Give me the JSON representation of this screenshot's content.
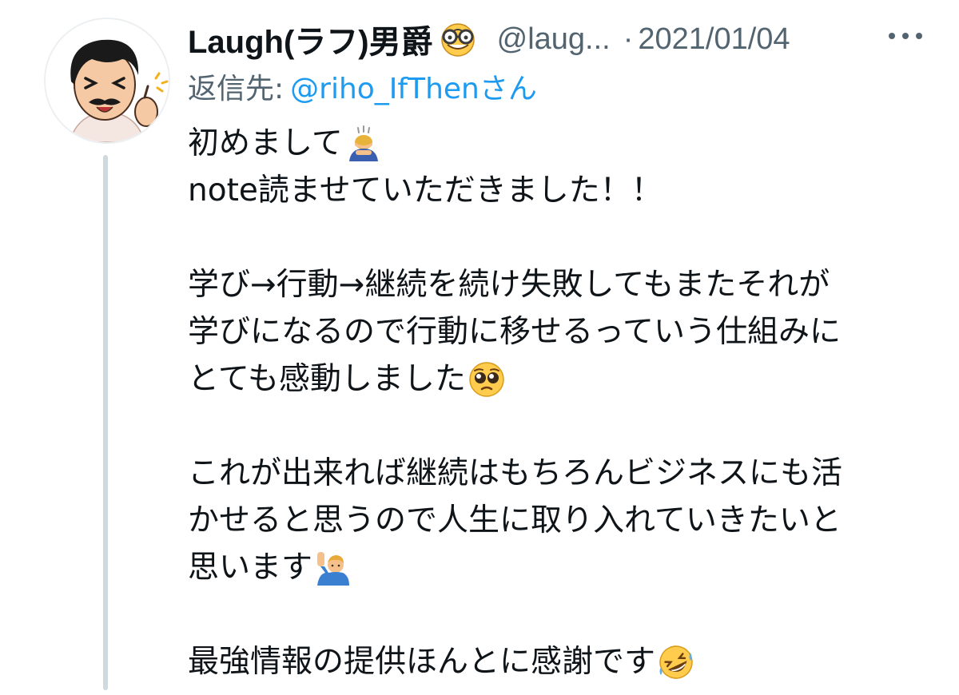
{
  "tweet": {
    "display_name": "Laugh(ラフ)男爵",
    "name_emoji": "nerd-face-emoji",
    "handle": "@laug...",
    "separator": "·",
    "date": "2021/01/04",
    "more_icon": "more-horizontal-icon",
    "reply_label": "返信先:",
    "reply_handle": "@riho_IfThenさん",
    "lines": [
      {
        "text": "初めまして",
        "emoji": "person-bowing-emoji"
      },
      {
        "text": "note読ませていただきました！！"
      },
      {
        "text": ""
      },
      {
        "text": "学び→行動→継続を続け失敗してもまたそれが"
      },
      {
        "text": "学びになるので行動に移せるっていう仕組みに"
      },
      {
        "text": "とても感動しました",
        "emoji": "pleading-face-emoji"
      },
      {
        "text": ""
      },
      {
        "text": "これが出来れば継続はもちろんビジネスにも活"
      },
      {
        "text": "かせると思うので人生に取り入れていきたいと"
      },
      {
        "text": "思います",
        "emoji": "person-raising-hand-emoji"
      },
      {
        "text": ""
      },
      {
        "text": "最強情報の提供ほんとに感謝です",
        "emoji": "rofl-emoji"
      }
    ]
  },
  "colors": {
    "text": "#0f1419",
    "muted": "#536471",
    "link": "#1d9bf0",
    "thread_line": "#cfd9de"
  }
}
